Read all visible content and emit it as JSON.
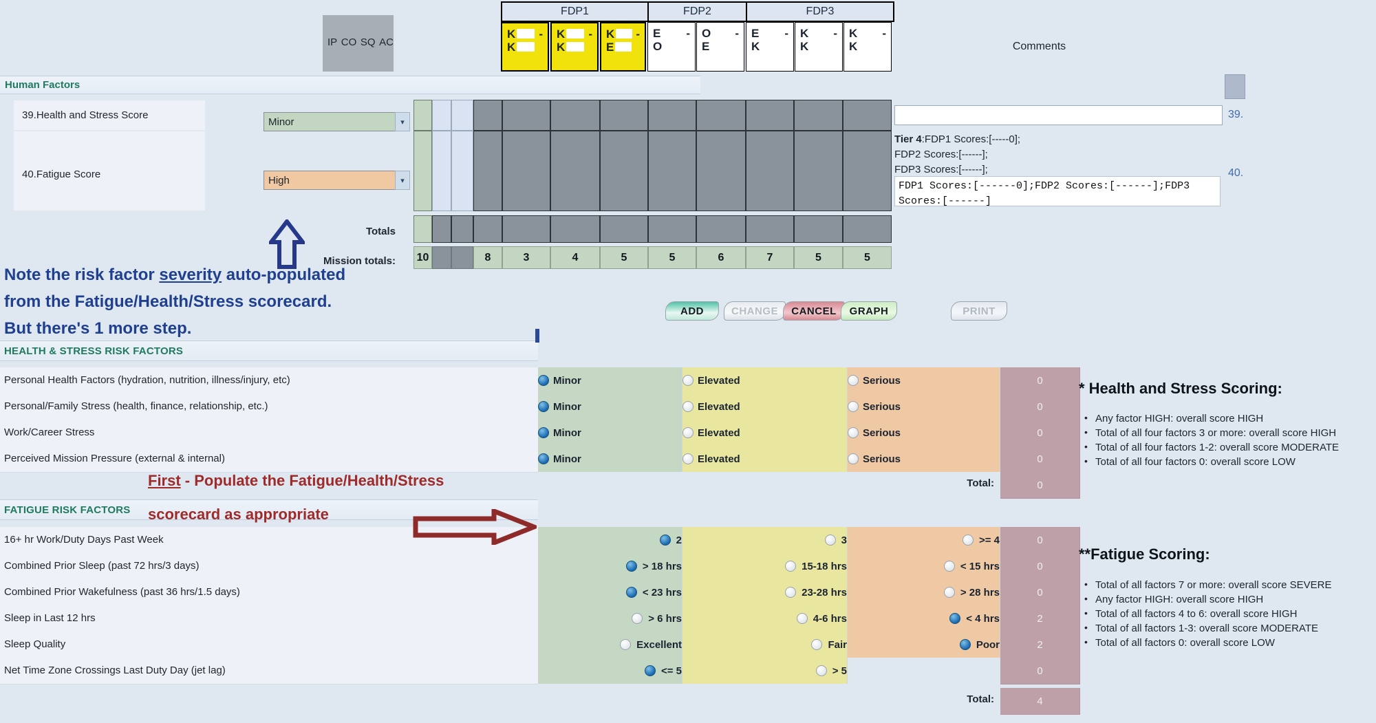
{
  "top_grid": {
    "ip_labels": [
      "IP",
      "CO",
      "SQ",
      "AC"
    ],
    "fdp_bands": [
      {
        "label": "FDP1"
      },
      {
        "label": "FDP2"
      },
      {
        "label": "FDP3"
      }
    ],
    "leg_cells": [
      {
        "from": "K",
        "to": "K",
        "dash": "-",
        "highlight": true
      },
      {
        "from": "K",
        "to": "K",
        "dash": "-",
        "highlight": true
      },
      {
        "from": "K",
        "to": "E",
        "dash": "-",
        "highlight": true
      },
      {
        "from": "E",
        "to": "O",
        "dash": "-",
        "highlight": false
      },
      {
        "from": "O",
        "to": "E",
        "dash": "-",
        "highlight": false
      },
      {
        "from": "E",
        "to": "K",
        "dash": "-",
        "highlight": false
      },
      {
        "from": "K",
        "to": "K",
        "dash": "-",
        "highlight": false
      },
      {
        "from": "K",
        "to": "K",
        "dash": "-",
        "highlight": false
      }
    ],
    "comments_header": "Comments",
    "section_title": "Human Factors",
    "rows": [
      {
        "label": "39.Health and Stress Score",
        "value": "Minor",
        "num": "39."
      },
      {
        "label": "40.Fatigue Score",
        "value": "High",
        "num": "40."
      }
    ],
    "totals_label": "Totals",
    "mission_totals_label": "Mission totals:",
    "mission_totals": [
      "10",
      "",
      "",
      "8",
      "3",
      "4",
      "5",
      "5",
      "6",
      "7",
      "5",
      "5"
    ],
    "comments": {
      "tier_bold": "Tier 4",
      "tier_line1": ":FDP1 Scores:[-----0];",
      "tier_line2": "FDP2 Scores:[------];",
      "tier_line3": "FDP3 Scores:[------];",
      "mono_text": "FDP1 Scores:[------0];FDP2 Scores:[------];FDP3 Scores:[------]"
    }
  },
  "buttons": {
    "add": "ADD",
    "change": "CHANGE",
    "cancel": "CANCEL",
    "graph": "GRAPH",
    "print": "PRINT"
  },
  "health_section": {
    "title": "HEALTH & STRESS RISK FACTORS",
    "column_labels": [
      "Minor",
      "Elevated",
      "Serious"
    ],
    "rows": [
      {
        "label": "Personal Health Factors (hydration, nutrition, illness/injury, etc)",
        "options": [
          "Minor",
          "Elevated",
          "Serious"
        ],
        "selected": 0,
        "score": "0"
      },
      {
        "label": "Personal/Family Stress (health, finance, relationship, etc.)",
        "options": [
          "Minor",
          "Elevated",
          "Serious"
        ],
        "selected": 0,
        "score": "0"
      },
      {
        "label": "Work/Career Stress",
        "options": [
          "Minor",
          "Elevated",
          "Serious"
        ],
        "selected": 0,
        "score": "0"
      },
      {
        "label": "Perceived Mission Pressure (external & internal)",
        "options": [
          "Minor",
          "Elevated",
          "Serious"
        ],
        "selected": 0,
        "score": "0"
      }
    ],
    "total_label": "Total:",
    "total_value": "0"
  },
  "fatigue_section": {
    "title": "FATIGUE RISK FACTORS",
    "rows": [
      {
        "label": "16+ hr Work/Duty Days Past Week",
        "options": [
          "2",
          "3",
          ">= 4"
        ],
        "selected": 0,
        "score": "0"
      },
      {
        "label": "Combined Prior Sleep (past 72 hrs/3 days)",
        "options": [
          "> 18 hrs",
          "15-18 hrs",
          "< 15 hrs"
        ],
        "selected": 0,
        "score": "0"
      },
      {
        "label": "Combined Prior Wakefulness (past 36 hrs/1.5 days)",
        "options": [
          "< 23 hrs",
          "23-28 hrs",
          "> 28 hrs"
        ],
        "selected": 0,
        "score": "0"
      },
      {
        "label": "Sleep in Last 12 hrs",
        "options": [
          "> 6 hrs",
          "4-6 hrs",
          "< 4 hrs"
        ],
        "selected": 2,
        "score": "2"
      },
      {
        "label": "Sleep Quality",
        "options": [
          "Excellent",
          "Fair",
          "Poor"
        ],
        "selected": 2,
        "score": "2"
      },
      {
        "label": "Net Time Zone Crossings Last Duty Day (jet lag)",
        "options": [
          "<= 5",
          "> 5",
          ""
        ],
        "selected": 0,
        "score": "0"
      }
    ],
    "total_label": "Total:",
    "total_value": "4"
  },
  "legends": [
    {
      "title": "* Health and Stress Scoring:",
      "items": [
        "Any factor HIGH: overall score HIGH",
        "Total of all four factors 3 or more: overall score HIGH",
        "Total of all four factors 1-2: overall score MODERATE",
        "Total of all four factors 0: overall score LOW"
      ]
    },
    {
      "title": "**Fatigue Scoring:",
      "items": [
        "Total of all factors 7 or more: overall score SEVERE",
        "Any factor HIGH: overall score HIGH",
        "Total of all factors 4 to 6: overall score HIGH",
        "Total of all factors 1-3: overall score MODERATE",
        "Total of all factors 0: overall score LOW"
      ]
    }
  ],
  "annotations": {
    "blue_line1_a": "Note the risk factor ",
    "blue_line1_u": "severity",
    "blue_line1_b": " auto-populated",
    "blue_line2": "from the Fatigue/Health/Stress scorecard.",
    "blue_line3": "But there's 1 more step.",
    "red_first": "First",
    "red_line1": " - Populate the Fatigue/Health/Stress",
    "red_line2": "scorecard as appropriate"
  }
}
